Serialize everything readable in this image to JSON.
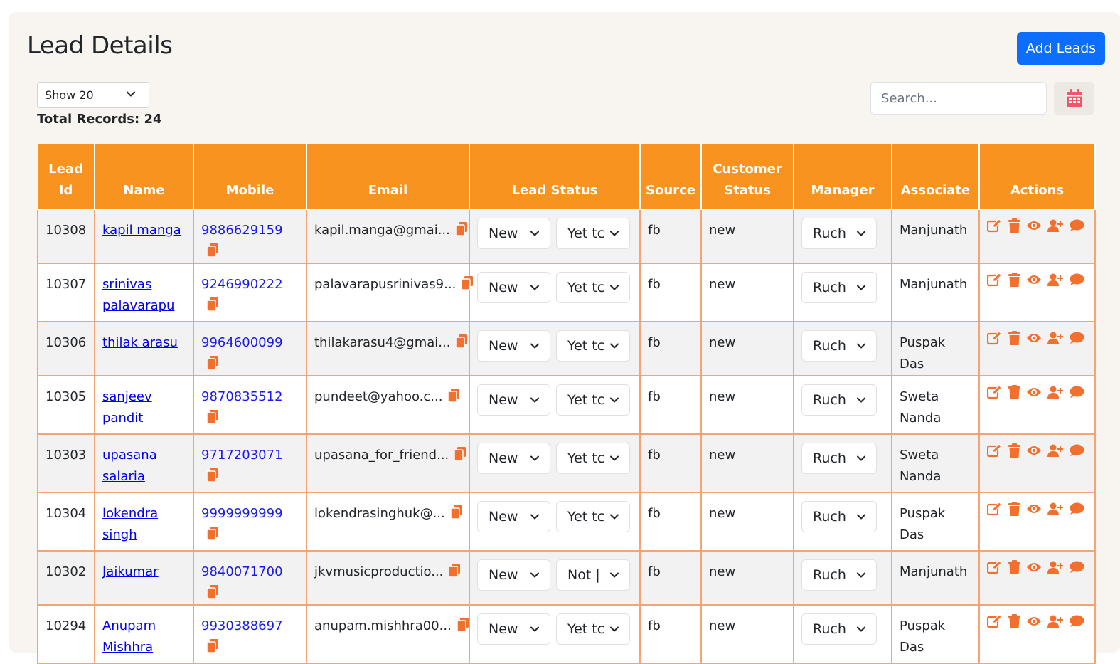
{
  "page": {
    "title": "Lead Details",
    "add_button": "Add Leads"
  },
  "controls": {
    "show_select": "Show 20",
    "total_records": "Total Records: 24",
    "search_placeholder": "Search..."
  },
  "colors": {
    "header": "#f7931e",
    "border": "#f7a472",
    "primary": "#0d6efd",
    "icon": "#f26f2d",
    "link": "#0000ee"
  },
  "table": {
    "columns": [
      "Lead\nId",
      "Name",
      "Mobile",
      "Email",
      "Lead Status",
      "Source",
      "Customer\nStatus",
      "Manager",
      "Associate",
      "Actions"
    ],
    "rows": [
      {
        "id": "10308",
        "name": "kapil manga",
        "mobile": "9886629159",
        "email": "kapil.manga@gmai...",
        "status": "New",
        "substatus": "Yet tc",
        "source": "fb",
        "customer_status": "new",
        "manager": "Ruch",
        "associate": "Manjunath"
      },
      {
        "id": "10307",
        "name": "srinivas palavarapu",
        "mobile": "9246990222",
        "email": "palavarapusrinivas9...",
        "status": "New",
        "substatus": "Yet tc",
        "source": "fb",
        "customer_status": "new",
        "manager": "Ruch",
        "associate": "Manjunath"
      },
      {
        "id": "10306",
        "name": "thilak arasu",
        "mobile": "9964600099",
        "email": "thilakarasu4@gmai...",
        "status": "New",
        "substatus": "Yet tc",
        "source": "fb",
        "customer_status": "new",
        "manager": "Ruch",
        "associate": "Puspak Das"
      },
      {
        "id": "10305",
        "name": "sanjeev pandit",
        "mobile": "9870835512",
        "email": "pundeet@yahoo.c...",
        "status": "New",
        "substatus": "Yet tc",
        "source": "fb",
        "customer_status": "new",
        "manager": "Ruch",
        "associate": "Sweta Nanda"
      },
      {
        "id": "10303",
        "name": "upasana salaria",
        "mobile": "9717203071",
        "email": "upasana_for_friend...",
        "status": "New",
        "substatus": "Yet tc",
        "source": "fb",
        "customer_status": "new",
        "manager": "Ruch",
        "associate": "Sweta Nanda"
      },
      {
        "id": "10304",
        "name": "lokendra singh",
        "mobile": "9999999999",
        "email": "lokendrasinghuk@...",
        "status": "New",
        "substatus": "Yet tc",
        "source": "fb",
        "customer_status": "new",
        "manager": "Ruch",
        "associate": "Puspak Das"
      },
      {
        "id": "10302",
        "name": "Jaikumar",
        "mobile": "9840071700",
        "email": "jkvmusicproductio...",
        "status": "New",
        "substatus": "Not |",
        "source": "fb",
        "customer_status": "new",
        "manager": "Ruch",
        "associate": "Manjunath"
      },
      {
        "id": "10294",
        "name": "Anupam Mishhra",
        "mobile": "9930388697",
        "email": "anupam.mishhra00...",
        "status": "New",
        "substatus": "Yet tc",
        "source": "fb",
        "customer_status": "new",
        "manager": "Ruch",
        "associate": "Puspak Das"
      }
    ]
  },
  "icons": [
    "edit-icon",
    "trash-icon",
    "eye-icon",
    "user-plus-icon",
    "comment-icon",
    "copy-icon",
    "calendar-icon",
    "chevron-down-icon"
  ]
}
